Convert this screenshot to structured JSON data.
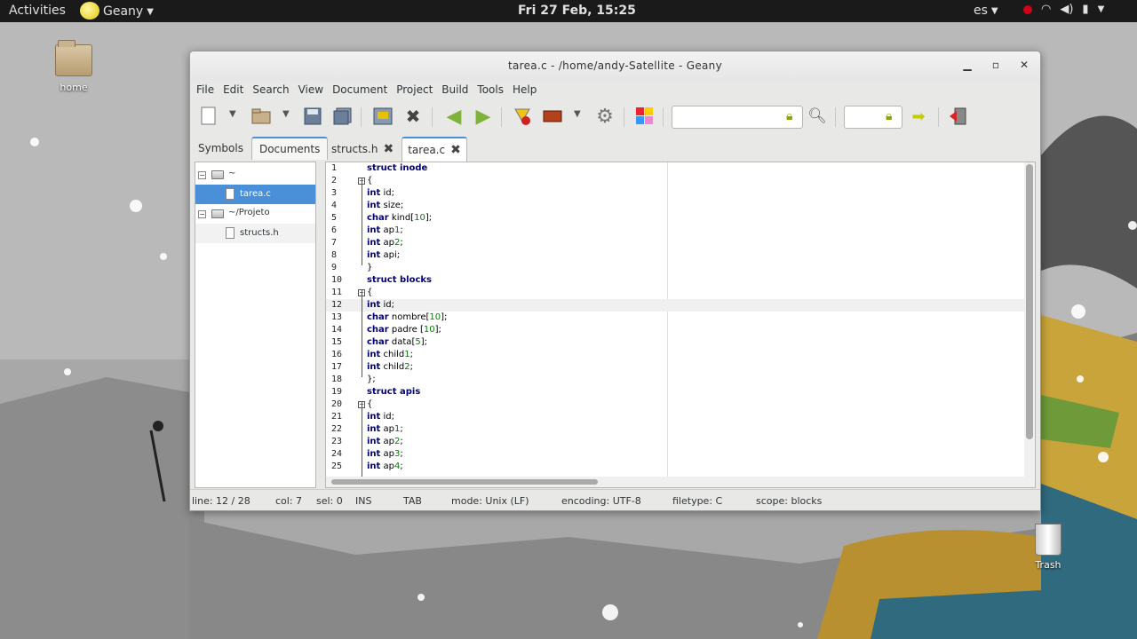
{
  "topbar": {
    "activities": "Activities",
    "app_name": "Geany",
    "clock": "Fri 27 Feb, 15:25",
    "lang": "es"
  },
  "desktop": {
    "home_label": "home",
    "trash_label": "Trash"
  },
  "window": {
    "title": "tarea.c - /home/andy-Satellite - Geany",
    "menu": [
      "File",
      "Edit",
      "Search",
      "View",
      "Document",
      "Project",
      "Build",
      "Tools",
      "Help"
    ]
  },
  "sidebar": {
    "tabs": [
      "Symbols",
      "Documents"
    ],
    "tree": {
      "root1": "~",
      "file1": "tarea.c",
      "root2": "~/Projeto",
      "file2": "structs.h"
    }
  },
  "editor_tabs": [
    "structs.h",
    "tarea.c"
  ],
  "code": [
    {
      "n": "1",
      "t": "struct inode"
    },
    {
      "n": "2",
      "t": "{"
    },
    {
      "n": "3",
      "t": "int id;"
    },
    {
      "n": "4",
      "t": "int size;"
    },
    {
      "n": "5",
      "t": "char kind[10];"
    },
    {
      "n": "6",
      "t": "int ap1;"
    },
    {
      "n": "7",
      "t": "int ap2;"
    },
    {
      "n": "8",
      "t": "int api;"
    },
    {
      "n": "9",
      "t": "}"
    },
    {
      "n": "10",
      "t": "struct blocks"
    },
    {
      "n": "11",
      "t": "{"
    },
    {
      "n": "12",
      "t": "int id;"
    },
    {
      "n": "13",
      "t": "char nombre[10];"
    },
    {
      "n": "14",
      "t": "char padre [10];"
    },
    {
      "n": "15",
      "t": "char data[5];"
    },
    {
      "n": "16",
      "t": "int child1;"
    },
    {
      "n": "17",
      "t": "int child2;"
    },
    {
      "n": "18",
      "t": "};"
    },
    {
      "n": "19",
      "t": "struct apis"
    },
    {
      "n": "20",
      "t": "{"
    },
    {
      "n": "21",
      "t": "int id;"
    },
    {
      "n": "22",
      "t": "int ap1;"
    },
    {
      "n": "23",
      "t": "int ap2;"
    },
    {
      "n": "24",
      "t": "int ap3;"
    },
    {
      "n": "25",
      "t": "int ap4;"
    }
  ],
  "statusbar": {
    "line": "line: 12 / 28",
    "col": "col: 7",
    "sel": "sel: 0",
    "ins": "INS",
    "tab": "TAB",
    "mode": "mode: Unix (LF)",
    "encoding": "encoding: UTF-8",
    "filetype": "filetype: C",
    "scope": "scope: blocks"
  },
  "colors": {
    "accent": "#4a90d9",
    "keyword": "#00007f",
    "number": "#007f00"
  }
}
